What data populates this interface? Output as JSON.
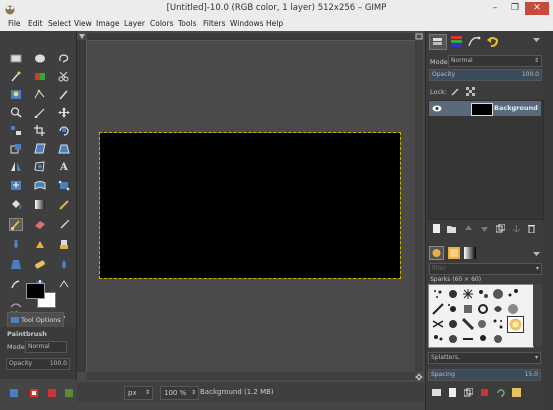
{
  "window": {
    "title": "[Untitled]-10.0 (RGB color, 1 layer) 512x256 – GIMP",
    "minimize": "–",
    "maximize": "❐",
    "close": "✕"
  },
  "menu": [
    "File",
    "Edit",
    "Select",
    "View",
    "Image",
    "Layer",
    "Colors",
    "Tools",
    "Filters",
    "Windows",
    "Help"
  ],
  "tool_options": {
    "tab_label": "Tool Options",
    "tool_name": "Paintbrush",
    "mode_label": "Mode",
    "mode_value": "Normal",
    "opacity_label": "Opacity",
    "opacity_value": "100.0"
  },
  "status": {
    "unit": "px",
    "zoom": "100 %",
    "info": "Background (1.2 MB)"
  },
  "layers": {
    "mode_label": "Mode:",
    "mode_value": "Normal",
    "opacity_label": "Opacity",
    "opacity_value": "100.0",
    "lock_label": "Lock:",
    "layer_name": "Background"
  },
  "brushes": {
    "filter_placeholder": "filter",
    "brush_info": "Sparks (60 × 60)",
    "tag_value": "Splatters,",
    "spacing_label": "Spacing",
    "spacing_value": "15.0"
  },
  "colors": {
    "foreground": "#000000",
    "background": "#ffffff",
    "selection": "#c8b400",
    "close_red": "#c74a3a"
  }
}
